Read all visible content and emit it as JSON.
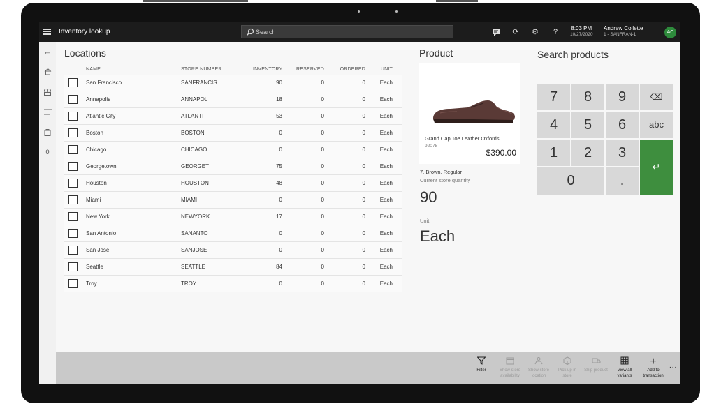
{
  "topbar": {
    "title": "Inventory lookup",
    "search_placeholder": "Search",
    "time": "8:03 PM",
    "date": "10/27/2020",
    "user_name": "Andrew Collette",
    "store_terminal": "1 - SANFRAN-1",
    "avatar_initials": "AC",
    "help_glyph": "?",
    "icons": [
      "hamburger-icon",
      "search-icon",
      "chat-icon",
      "refresh-icon",
      "settings-icon",
      "help-icon"
    ]
  },
  "rail": {
    "badge_count": "0",
    "icons": [
      "back-arrow-icon",
      "home-icon",
      "products-icon",
      "list-icon",
      "bag-icon"
    ]
  },
  "locations": {
    "title": "Locations",
    "columns": [
      "NAME",
      "STORE NUMBER",
      "INVENTORY",
      "RESERVED",
      "ORDERED",
      "UNIT"
    ],
    "rows": [
      {
        "name": "San Francisco",
        "store": "SANFRANCIS",
        "inventory": "90",
        "reserved": "0",
        "ordered": "0",
        "unit": "Each"
      },
      {
        "name": "Annapolis",
        "store": "ANNAPOL",
        "inventory": "18",
        "reserved": "0",
        "ordered": "0",
        "unit": "Each"
      },
      {
        "name": "Atlantic City",
        "store": "ATLANTI",
        "inventory": "53",
        "reserved": "0",
        "ordered": "0",
        "unit": "Each"
      },
      {
        "name": "Boston",
        "store": "BOSTON",
        "inventory": "0",
        "reserved": "0",
        "ordered": "0",
        "unit": "Each"
      },
      {
        "name": "Chicago",
        "store": "CHICAGO",
        "inventory": "0",
        "reserved": "0",
        "ordered": "0",
        "unit": "Each"
      },
      {
        "name": "Georgetown",
        "store": "GEORGET",
        "inventory": "75",
        "reserved": "0",
        "ordered": "0",
        "unit": "Each"
      },
      {
        "name": "Houston",
        "store": "HOUSTON",
        "inventory": "48",
        "reserved": "0",
        "ordered": "0",
        "unit": "Each"
      },
      {
        "name": "Miami",
        "store": "MIAMI",
        "inventory": "0",
        "reserved": "0",
        "ordered": "0",
        "unit": "Each"
      },
      {
        "name": "New York",
        "store": "NEWYORK",
        "inventory": "17",
        "reserved": "0",
        "ordered": "0",
        "unit": "Each"
      },
      {
        "name": "San Antonio",
        "store": "SANANTO",
        "inventory": "0",
        "reserved": "0",
        "ordered": "0",
        "unit": "Each"
      },
      {
        "name": "San Jose",
        "store": "SANJOSE",
        "inventory": "0",
        "reserved": "0",
        "ordered": "0",
        "unit": "Each"
      },
      {
        "name": "Seattle",
        "store": "SEATTLE",
        "inventory": "84",
        "reserved": "0",
        "ordered": "0",
        "unit": "Each"
      },
      {
        "name": "Troy",
        "store": "TROY",
        "inventory": "0",
        "reserved": "0",
        "ordered": "0",
        "unit": "Each"
      }
    ]
  },
  "product": {
    "title": "Product",
    "name": "Grand Cap Toe Leather Oxfords",
    "id": "92078",
    "price": "$390.00",
    "variant": "7, Brown, Regular",
    "current_store_quantity_label": "Current store quantity",
    "current_store_quantity": "90",
    "unit_label": "Unit",
    "unit": "Each",
    "image_icon": "shoe-icon"
  },
  "search_products": {
    "title": "Search products",
    "keys": {
      "k7": "7",
      "k8": "8",
      "k9": "9",
      "backspace": "⌫",
      "k4": "4",
      "k5": "5",
      "k6": "6",
      "abc": "abc",
      "k1": "1",
      "k2": "2",
      "k3": "3",
      "enter": "↵",
      "k0": "0",
      "dot": "."
    }
  },
  "actions": [
    {
      "icon": "filter-icon",
      "label": "Filter",
      "enabled": true
    },
    {
      "icon": "calendar-icon",
      "label": "Show store availability",
      "enabled": false
    },
    {
      "icon": "store-location-icon",
      "label": "Show store location",
      "enabled": false
    },
    {
      "icon": "pickup-icon",
      "label": "Pick up in store",
      "enabled": false
    },
    {
      "icon": "ship-icon",
      "label": "Ship product",
      "enabled": false
    },
    {
      "icon": "grid-icon",
      "label": "View all variants",
      "enabled": true
    },
    {
      "icon": "plus-icon",
      "label": "Add to transaction",
      "enabled": true
    }
  ],
  "more_label": "...",
  "colors": {
    "topbar": "#1c1c1c",
    "avatar": "#2e8b3c",
    "enter_key": "#3e8e3e",
    "keypad": "#d8d8d8",
    "action_bar": "#c9c9c9"
  }
}
